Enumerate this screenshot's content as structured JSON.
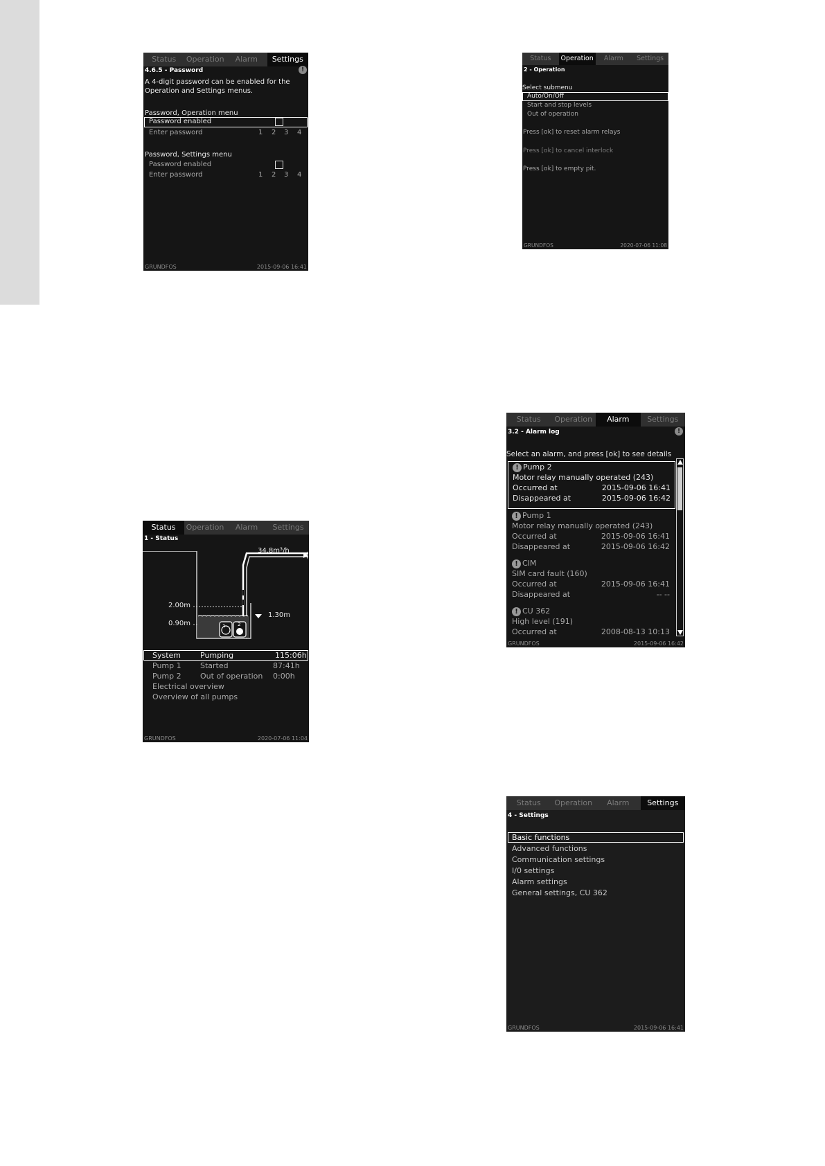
{
  "tabs": [
    "Status",
    "Operation",
    "Alarm",
    "Settings"
  ],
  "password_screen": {
    "active_tab": "Settings",
    "heading": "4.6.5 - Password",
    "description_line1": "A 4-digit password can be enabled for the",
    "description_line2": "Operation and Settings menus.",
    "operation_section": "Password, Operation menu",
    "settings_section": "Password, Settings menu",
    "password_enabled_label": "Password enabled",
    "enter_password_label": "Enter password",
    "digits": [
      "1",
      "2",
      "3",
      "4"
    ],
    "brand": "GRUNDFOS",
    "timestamp": "2015-09-06  16:41"
  },
  "operation_screen": {
    "active_tab": "Operation",
    "heading": "2 - Operation",
    "select_label": "Select submenu",
    "items": [
      "Auto/On/Off",
      "Start and stop levels",
      "Out of operation"
    ],
    "reset_alarm": "Press [ok] to reset alarm relays",
    "cancel_interlock": "Press [ok] to cancel interlock",
    "empty_pit": "Press [ok] to empty pit.",
    "brand": "GRUNDFOS",
    "timestamp": "2020-07-06  11:08"
  },
  "alarm_screen": {
    "active_tab": "Alarm",
    "heading": "3.2 - Alarm log",
    "instruction": "Select an alarm, and press [ok] to see details",
    "occurred_label": "Occurred at",
    "disappeared_label": "Disappeared at",
    "entries": [
      {
        "source": "Pump 2",
        "description": "Motor relay manually operated (243)",
        "occurred": "2015-09-06  16:41",
        "disappeared": "2015-09-06  16:42"
      },
      {
        "source": "Pump 1",
        "description": "Motor relay manually operated (243)",
        "occurred": "2015-09-06  16:41",
        "disappeared": "2015-09-06  16:42"
      },
      {
        "source": "CIM",
        "description": "SIM card fault (160)",
        "occurred": "2015-09-06  16:41",
        "disappeared": "--    --"
      },
      {
        "source": "CU 362",
        "description": "High level (191)",
        "occurred": "2008-08-13  10:13",
        "disappeared": ""
      }
    ],
    "brand": "GRUNDFOS",
    "timestamp": "2015-09-06  16:42"
  },
  "status_screen": {
    "active_tab": "Status",
    "heading": "1 - Status",
    "flow": "34.8m³/h",
    "level_high": "2.00m",
    "level_low": "0.90m",
    "level_current": "1.30m",
    "pump1_badge": "1",
    "pump2_badge": "2",
    "rows": [
      {
        "name": "System",
        "state": "Pumping",
        "value": "115:06h"
      },
      {
        "name": "Pump 1",
        "state": "Started",
        "value": "87:41h"
      },
      {
        "name": "Pump 2",
        "state": "Out of operation",
        "value": "0:00h"
      }
    ],
    "electrical_overview": "Electrical overview",
    "overview_all_pumps": "Overview of all pumps",
    "brand": "GRUNDFOS",
    "timestamp": "2020-07-06  11:04"
  },
  "settings_screen": {
    "active_tab": "Settings",
    "heading": "4 - Settings",
    "items": [
      "Basic functions",
      "Advanced functions",
      "Communication settings",
      "I/0 settings",
      "Alarm settings",
      "General settings, CU 362"
    ],
    "brand": "GRUNDFOS",
    "timestamp": "2015-09-06  16:41"
  },
  "colors": {
    "screen_bg": "#151515",
    "tab_bar": "#303030",
    "text": "#e6e6e6",
    "page": "#ffffff",
    "sidebar": "#dcdcdc"
  }
}
